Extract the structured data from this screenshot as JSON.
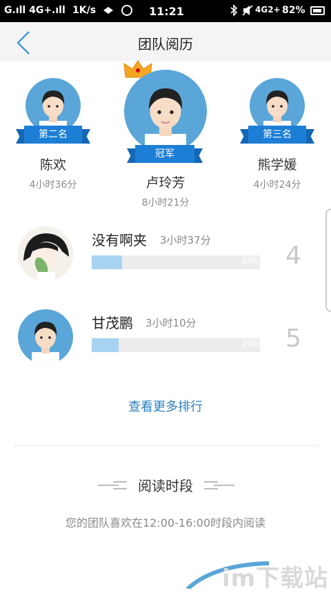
{
  "status_bar": {
    "signal": "G.ıll 4G+.ıll",
    "speed": "1K/s",
    "time": "11:21",
    "network": "4G2+",
    "battery": "82%"
  },
  "header": {
    "title": "团队阅历"
  },
  "podium": [
    {
      "rank_label": "第二名",
      "name": "陈欢",
      "time": "4小时36分"
    },
    {
      "rank_label": "冠军",
      "name": "卢玲芳",
      "time": "8小时21分"
    },
    {
      "rank_label": "第三名",
      "name": "熊学媛",
      "time": "4小时24分"
    }
  ],
  "ranking": [
    {
      "name": "没有啊夹",
      "time": "3小时37分",
      "goal": "20h",
      "rank": "4",
      "progress": 0.18
    },
    {
      "name": "甘茂鹏",
      "time": "3小时10分",
      "goal": "20h",
      "rank": "5",
      "progress": 0.16
    }
  ],
  "more_link": "查看更多排行",
  "reading_period": {
    "title": "阅读时段",
    "description": "您的团队喜欢在12:00-16:00时段内阅读"
  },
  "watermark": "im下载站",
  "colors": {
    "accent": "#1d7ed6",
    "avatar_bg": "#5aa6d8",
    "progress_fill": "#a9d3f3",
    "link": "#2c7fbf"
  }
}
